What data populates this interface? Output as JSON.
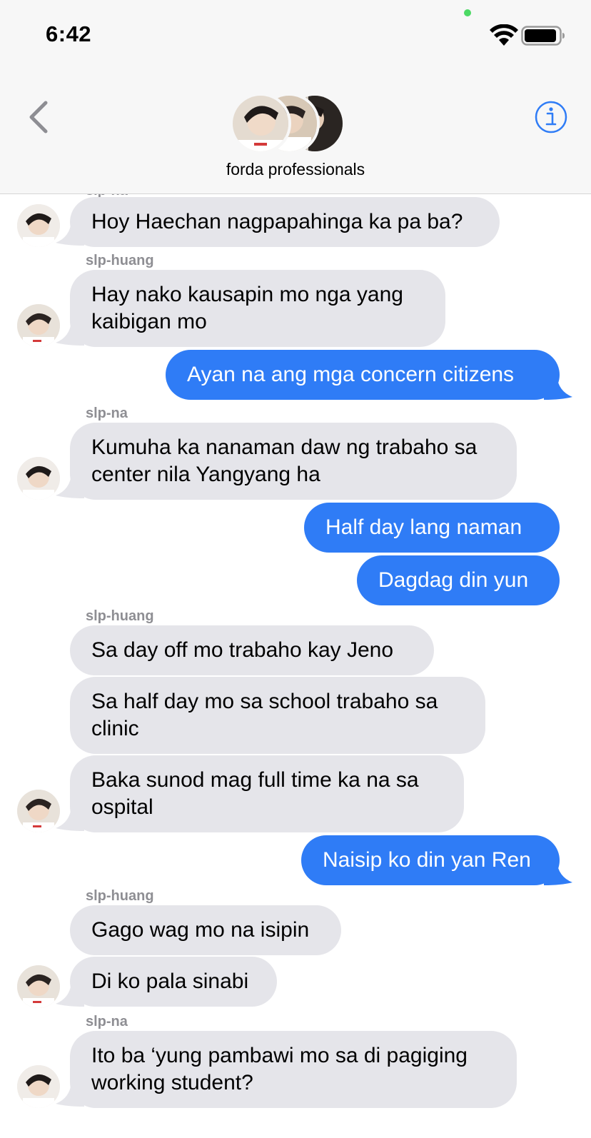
{
  "status": {
    "time": "6:42"
  },
  "header": {
    "group_name": "forda professionals"
  },
  "colors": {
    "incoming": "#e5e5ea",
    "outgoing": "#2f7cf6",
    "accent": "#2f7cf6"
  },
  "icons": {
    "back": "chevron-left-icon",
    "info": "info-icon"
  },
  "messages": [
    {
      "sender": "slp-na",
      "text": "Hoy Haechan nagpapahinga ka pa ba?",
      "direction": "in"
    },
    {
      "sender": "slp-huang",
      "text": "Hay nako kausapin mo nga yang\nkaibigan mo",
      "direction": "in"
    },
    {
      "text": "Ayan  na ang mga concern citizens",
      "direction": "out"
    },
    {
      "sender": "slp-na",
      "text": "Kumuha ka nanaman daw ng trabaho sa\ncenter nila Yangyang ha",
      "direction": "in"
    },
    {
      "text": "Half day lang naman",
      "direction": "out"
    },
    {
      "text": "Dagdag din yun",
      "direction": "out"
    },
    {
      "sender": "slp-huang",
      "text": "Sa day off mo trabaho kay Jeno",
      "direction": "in"
    },
    {
      "text": "Sa half day mo sa school trabaho sa\nclinic",
      "direction": "in"
    },
    {
      "text": "Baka sunod mag full time ka na sa\nospital",
      "direction": "in"
    },
    {
      "text": "Naisip ko din yan Ren",
      "direction": "out"
    },
    {
      "sender": "slp-huang",
      "text": "Gago wag mo na isipin",
      "direction": "in"
    },
    {
      "text": "Di ko pala sinabi",
      "direction": "in"
    },
    {
      "sender": "slp-na",
      "text": "Ito ba ‘yung pambawi mo sa di pagiging\nworking student?",
      "direction": "in"
    }
  ]
}
